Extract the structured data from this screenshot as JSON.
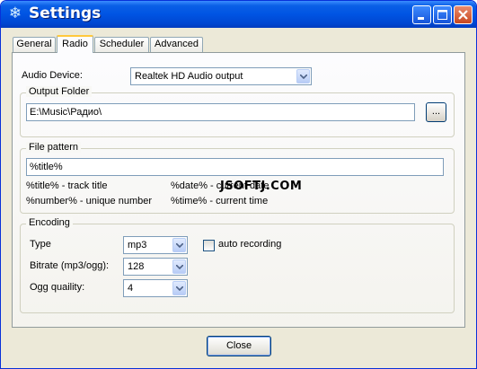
{
  "window": {
    "title": "Settings",
    "app_icon": "snowflake-icon",
    "controls": [
      "minimize-icon",
      "maximize-icon",
      "close-icon"
    ]
  },
  "tabs": [
    {
      "label": "General",
      "active": false
    },
    {
      "label": "Radio",
      "active": true
    },
    {
      "label": "Scheduler",
      "active": false
    },
    {
      "label": "Advanced",
      "active": false
    }
  ],
  "audio_device": {
    "label": "Audio Device:",
    "value": "Realtek HD Audio output"
  },
  "output_folder": {
    "title": "Output Folder",
    "value": "E:\\Music\\Радио\\",
    "browse_label": "..."
  },
  "file_pattern": {
    "title": "File pattern",
    "value": "%title%",
    "hints": [
      "%title% - track title",
      "%date% - current date",
      "%number% - unique number",
      "%time% - current time"
    ]
  },
  "encoding": {
    "title": "Encoding",
    "type_label": "Type",
    "type_value": "mp3",
    "bitrate_label": "Bitrate (mp3/ogg):",
    "bitrate_value": "128",
    "ogg_quality_label": "Ogg quaility:",
    "ogg_quality_value": "4",
    "auto_recording_label": "auto recording",
    "auto_recording_checked": false
  },
  "watermark": "JSOFTJ.COM",
  "close_label": "Close",
  "colors": {
    "titlebar": "#0054E3",
    "tab_highlight": "#FFC83C",
    "window_bg": "#ECE9D8"
  }
}
